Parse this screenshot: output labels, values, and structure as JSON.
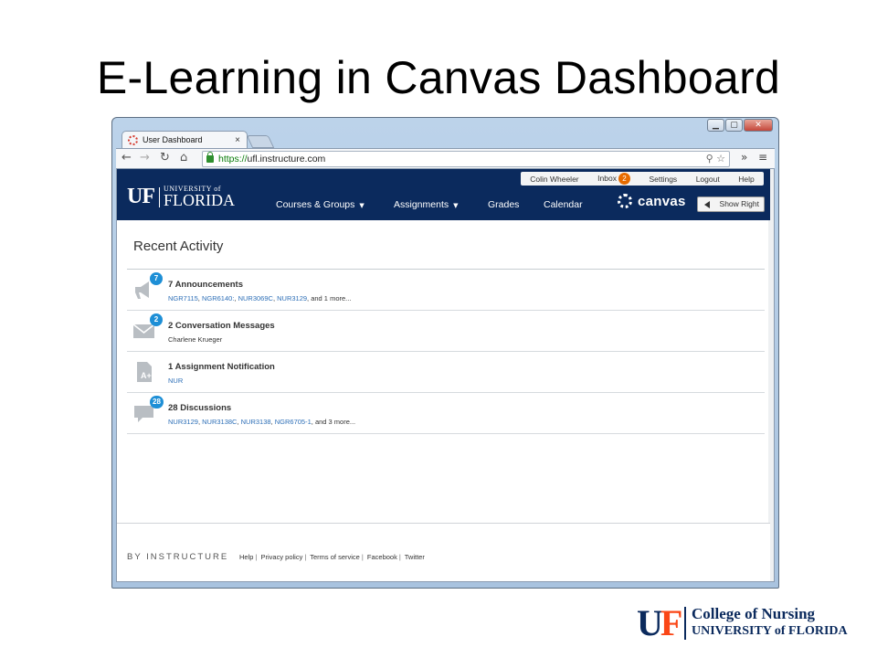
{
  "slide": {
    "title": "E-Learning in Canvas Dashboard"
  },
  "browser": {
    "tab_title": "User Dashboard",
    "tab_close": "×",
    "url_scheme": "https://",
    "url_rest": "ufl.instructure.com",
    "window_controls": [
      "▁",
      "▢",
      "✕"
    ]
  },
  "user_bar": {
    "user": "Colin Wheeler",
    "inbox_label": "Inbox",
    "inbox_count": "2",
    "settings": "Settings",
    "logout": "Logout",
    "help": "Help"
  },
  "header": {
    "logo_uf": "UF",
    "logo_university": "UNIVERSITY of",
    "logo_florida": "FLORIDA",
    "nav": [
      "Courses & Groups",
      "Assignments",
      "Grades",
      "Calendar"
    ],
    "canvas_brand": "canvas",
    "show_right": "Show Right"
  },
  "recent_activity": {
    "heading": "Recent Activity",
    "items": [
      {
        "icon": "megaphone-icon",
        "badge": "7",
        "title": "7 Announcements",
        "links": [
          "NGR7115",
          "NGR6140:",
          "NUR3069C",
          "NUR3129"
        ],
        "more": ", and 1 more..."
      },
      {
        "icon": "envelope-icon",
        "badge": "2",
        "title": "2 Conversation Messages",
        "text": "Charlene Krueger"
      },
      {
        "icon": "assignment-grade-icon",
        "badge": "",
        "title": "1 Assignment Notification",
        "links": [
          "NUR"
        ],
        "more": ""
      },
      {
        "icon": "discussion-bubble-icon",
        "badge": "28",
        "title": "28 Discussions",
        "links": [
          "NUR3129",
          "NUR3138C",
          "NUR3138",
          "NGR6705-1"
        ],
        "more": ", and 3 more..."
      }
    ]
  },
  "footer": {
    "brand": "BY INSTRUCTURE",
    "links": [
      "Help",
      "Privacy policy",
      "Terms of service",
      "Facebook",
      "Twitter"
    ]
  },
  "corner_logo": {
    "uf_u": "U",
    "uf_f": "F",
    "line1": "College of Nursing",
    "line2": "UNIVERSITY of FLORIDA"
  },
  "colors": {
    "header_navy": "#0b2a5d",
    "badge_blue": "#1e8fd6",
    "inbox_orange": "#e66b00",
    "link_blue": "#2d6fb7",
    "uf_orange": "#fa4616"
  }
}
